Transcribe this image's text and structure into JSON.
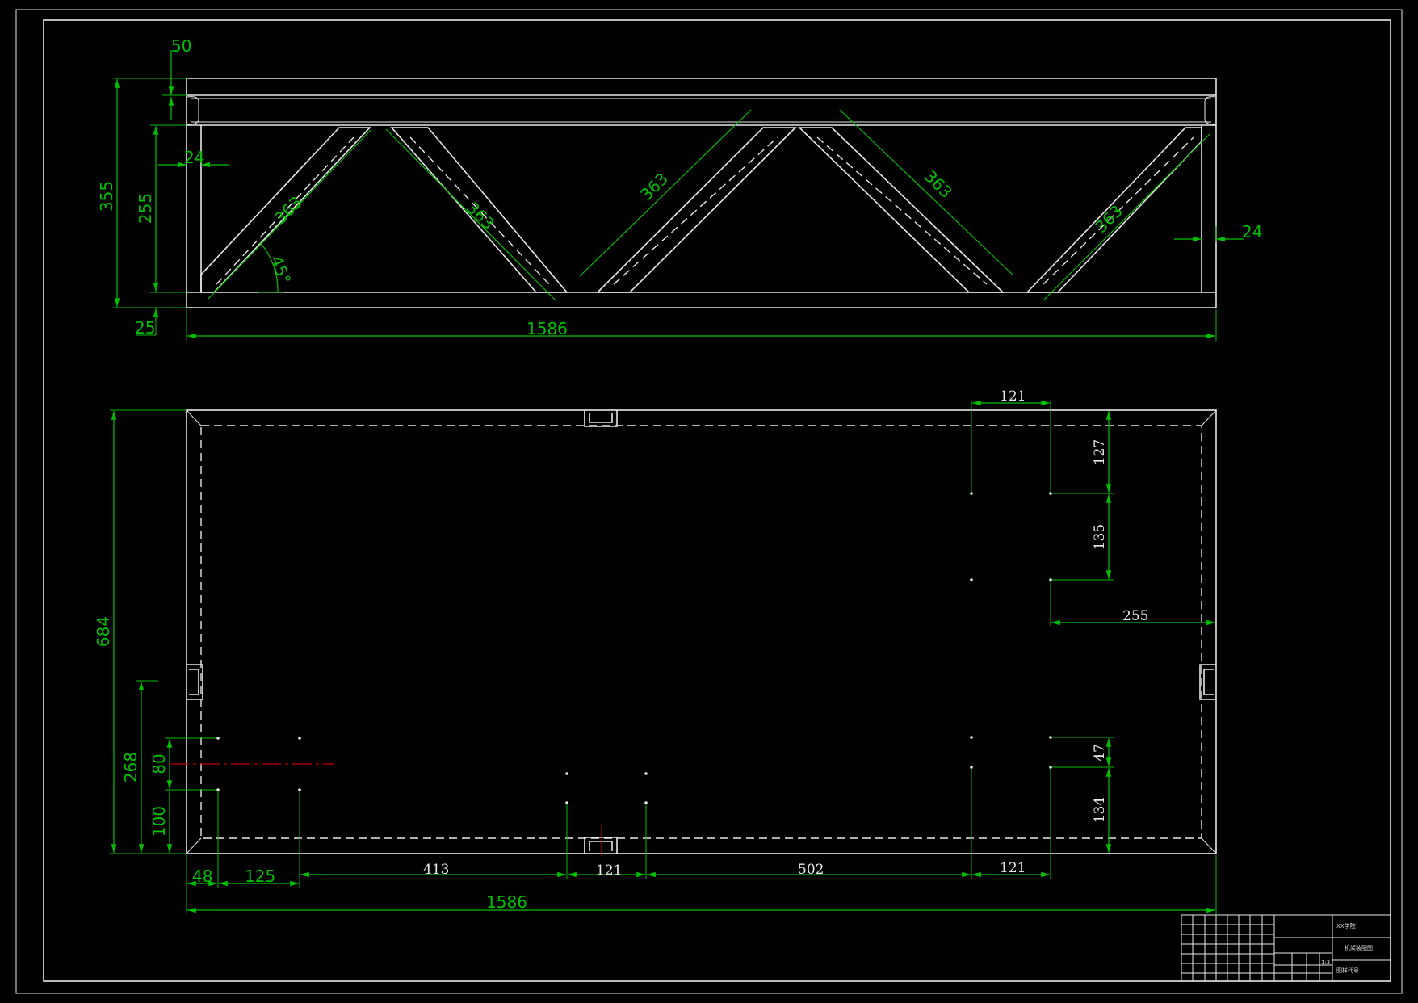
{
  "front_view": {
    "dims": {
      "flange_thickness": "50",
      "total_height": "355",
      "inner_height": "255",
      "post_width_left": "24",
      "post_width_right": "24",
      "bottom_flange": "25",
      "overall_length": "1586",
      "diagonal_length": "363",
      "diagonal_angle": "45°"
    }
  },
  "plan_view": {
    "dims": {
      "overall_width": "684",
      "overall_length": "1586",
      "left_hole_height": "268",
      "hole_spacing_80": "80",
      "hole_offset_100": "100",
      "left_edge_48": "48",
      "left_spacing_125": "125",
      "span_413": "413",
      "center_spacing_121": "121",
      "span_502": "502",
      "right_spacing_121_bottom": "121",
      "right_spacing_121_top": "121",
      "top_offset_127": "127",
      "vertical_135": "135",
      "right_offset_255": "255",
      "vertical_47": "47",
      "vertical_134": "134"
    }
  },
  "title_block": {
    "school": "XX学院",
    "drawing_title": "机架装配图",
    "drawing_no": "图样代号",
    "scale": "1:3"
  },
  "colors": {
    "background": "#000000",
    "geometry": "#e8e8e8",
    "dimension": "#00c000",
    "centerline": "#c00000"
  }
}
